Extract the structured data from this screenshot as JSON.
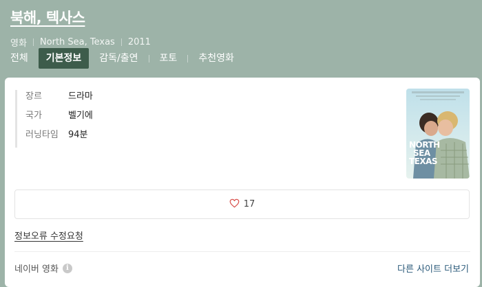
{
  "header": {
    "title": "북해, 텍사스",
    "meta": {
      "type": "영화",
      "original_title": "North Sea, Texas",
      "year": "2011"
    }
  },
  "tabs": [
    {
      "label": "전체",
      "active": false
    },
    {
      "label": "기본정보",
      "active": true
    },
    {
      "label": "감독/출연",
      "active": false
    },
    {
      "label": "포토",
      "active": false
    },
    {
      "label": "추천영화",
      "active": false
    }
  ],
  "info": {
    "genre": {
      "key": "장르",
      "value": "드라마"
    },
    "country": {
      "key": "국가",
      "value": "벨기에"
    },
    "runtime": {
      "key": "러닝타임",
      "value": "94분"
    }
  },
  "poster": {
    "title_line1": "NORTH",
    "title_line2": "SEA",
    "title_line3": "TEXAS"
  },
  "like": {
    "icon": "heart-icon",
    "count": "17"
  },
  "report_link": "정보오류 수정요청",
  "footer": {
    "source": "네이버 영화",
    "info_icon": "i",
    "more_sites": "다른 사이트 더보기"
  },
  "colors": {
    "header_bg": "#9db3a8",
    "active_tab_bg": "#3d5c4b",
    "link": "#2b5a7a",
    "heart": "#d9534f"
  }
}
